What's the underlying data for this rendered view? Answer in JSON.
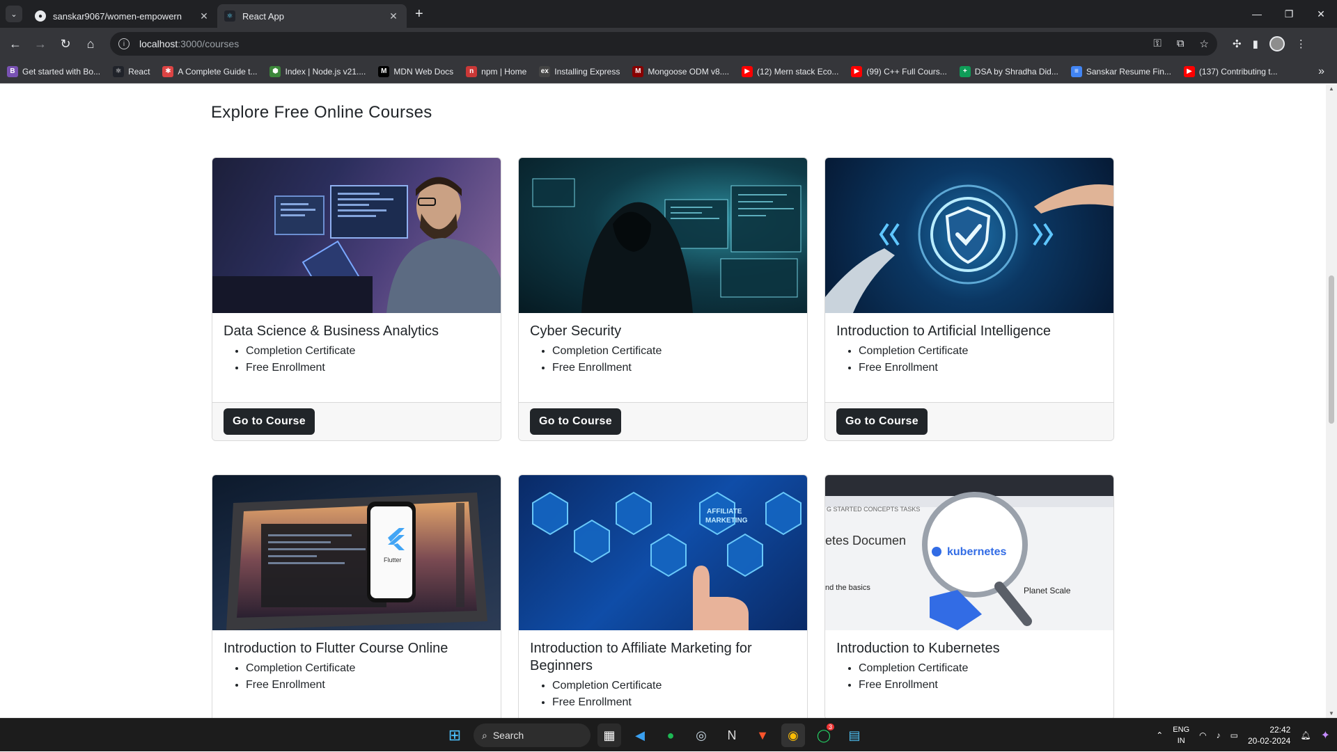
{
  "browser": {
    "tabs": [
      {
        "title": "sanskar9067/women-empowern",
        "icon": "github-icon",
        "active": false
      },
      {
        "title": "React App",
        "icon": "react-icon",
        "active": true
      }
    ],
    "url_host": "localhost",
    "url_path": ":3000/courses",
    "bookmarks": [
      {
        "label": "Get started with Bo...",
        "icon": "bootstrap-icon",
        "color": "#7952b3",
        "glyph": "B"
      },
      {
        "label": "React",
        "icon": "react-icon",
        "color": "#20232a",
        "glyph": "⚛"
      },
      {
        "label": "A Complete Guide t...",
        "icon": "asterisk-icon",
        "color": "#d44",
        "glyph": "✱"
      },
      {
        "label": "Index | Node.js v21....",
        "icon": "nodejs-icon",
        "color": "#3c873a",
        "glyph": "⬢"
      },
      {
        "label": "MDN Web Docs",
        "icon": "mdn-icon",
        "color": "#000",
        "glyph": "M"
      },
      {
        "label": "npm | Home",
        "icon": "npm-icon",
        "color": "#cb3837",
        "glyph": "n"
      },
      {
        "label": "Installing Express",
        "icon": "express-icon",
        "color": "#444",
        "glyph": "ex"
      },
      {
        "label": "Mongoose ODM v8....",
        "icon": "mongoose-icon",
        "color": "#800",
        "glyph": "M"
      },
      {
        "label": "(12) Mern stack Eco...",
        "icon": "youtube-icon",
        "color": "#f00",
        "glyph": "▶"
      },
      {
        "label": "(99) C++ Full Cours...",
        "icon": "youtube-icon",
        "color": "#f00",
        "glyph": "▶"
      },
      {
        "label": "DSA by Shradha Did...",
        "icon": "sheets-icon",
        "color": "#0f9d58",
        "glyph": "+"
      },
      {
        "label": "Sanskar Resume Fin...",
        "icon": "docs-icon",
        "color": "#4285f4",
        "glyph": "≡"
      },
      {
        "label": "(137) Contributing t...",
        "icon": "youtube-icon",
        "color": "#f00",
        "glyph": "▶"
      }
    ]
  },
  "page": {
    "heading": "Explore Free Online Courses",
    "button_label": "Go to Course",
    "courses": [
      {
        "title": "Data Science & Business Analytics",
        "features": [
          "Completion Certificate",
          "Free Enrollment"
        ],
        "image": "developer-at-monitors"
      },
      {
        "title": "Cyber Security",
        "features": [
          "Completion Certificate",
          "Free Enrollment"
        ],
        "image": "hooded-hacker"
      },
      {
        "title": "Introduction to Artificial Intelligence",
        "features": [
          "Completion Certificate",
          "Free Enrollment"
        ],
        "image": "robot-hand-shield"
      },
      {
        "title": "Introduction to Flutter Course Online",
        "features": [
          "Completion Certificate",
          "Free Enrollment"
        ],
        "image": "laptop-flutter-phone"
      },
      {
        "title": "Introduction to Affiliate Marketing for Beginners",
        "features": [
          "Completion Certificate",
          "Free Enrollment"
        ],
        "image": "affiliate-marketing-hexagons"
      },
      {
        "title": "Introduction to Kubernetes",
        "features": [
          "Completion Certificate",
          "Free Enrollment"
        ],
        "image": "kubernetes-magnifier"
      }
    ]
  },
  "taskbar": {
    "search_label": "Search",
    "lang_top": "ENG",
    "lang_bottom": "IN",
    "time": "22:42",
    "date": "20-02-2024",
    "whatsapp_badge": "3"
  }
}
